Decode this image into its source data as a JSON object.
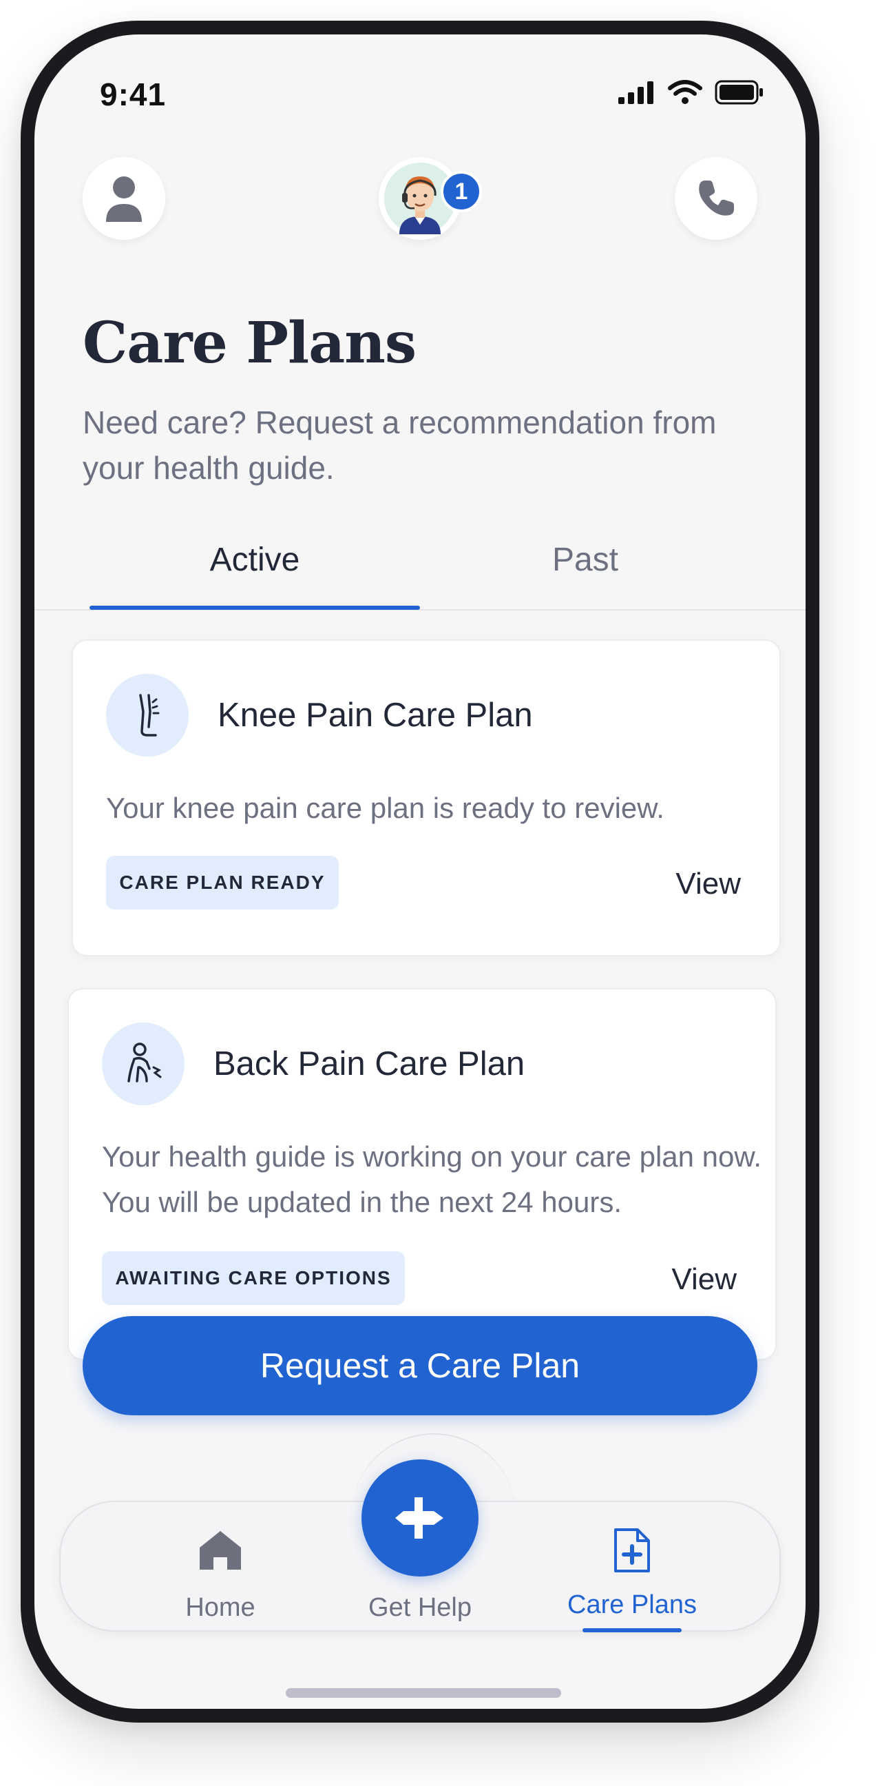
{
  "status_bar": {
    "time": "9:41"
  },
  "header": {
    "badge_count": "1",
    "title": "Care Plans",
    "subtitle": "Need care? Request a recommendation from your health guide."
  },
  "tabs": [
    {
      "label": "Active",
      "active": true
    },
    {
      "label": "Past",
      "active": false
    }
  ],
  "care_plans": [
    {
      "title": "Knee Pain Care Plan",
      "description": "Your knee pain care plan is ready to review.",
      "status": "CARE PLAN READY",
      "action": "View",
      "icon": "knee-pain-icon"
    },
    {
      "title": "Back Pain Care Plan",
      "description": "Your health guide is working on your care plan now. You will be updated in the next 24 hours.",
      "status": "AWAITING CARE OPTIONS",
      "action": "View",
      "icon": "back-pain-icon"
    }
  ],
  "cta": {
    "label": "Request a Care Plan"
  },
  "bottom_nav": [
    {
      "label": "Home",
      "icon": "home-icon",
      "active": false
    },
    {
      "label": "Get Help",
      "icon": "signpost-icon",
      "active": false
    },
    {
      "label": "Care Plans",
      "icon": "care-plan-document-icon",
      "active": true
    }
  ],
  "colors": {
    "accent": "#2263d2",
    "pill_bg": "#e1edfc",
    "text_primary": "#232838",
    "text_secondary": "#6d7080"
  }
}
